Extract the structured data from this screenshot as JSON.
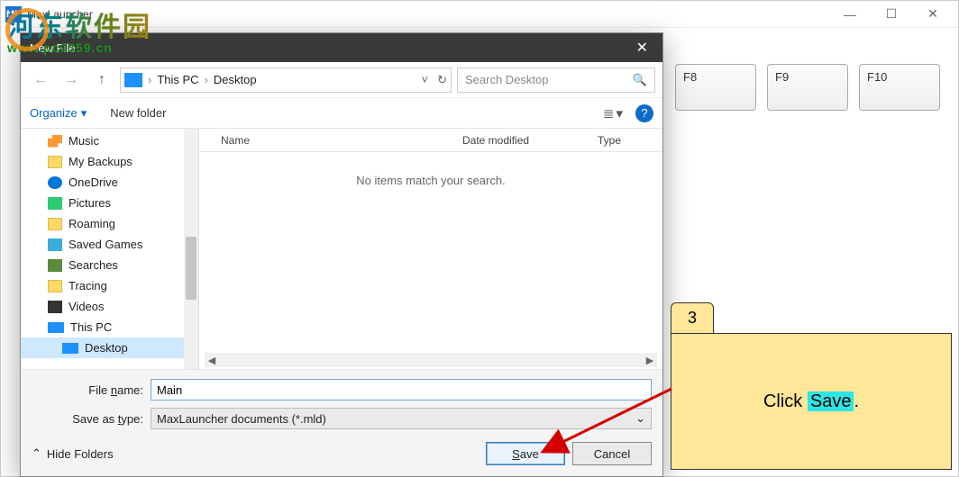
{
  "app": {
    "title": "MaxLauncher",
    "icon_text": "ML",
    "win": {
      "min": "—",
      "max": "☐",
      "close": "✕"
    },
    "f_buttons": [
      "F8",
      "F9",
      "F10"
    ]
  },
  "watermark": {
    "line1": "河东软件园",
    "line2": "www.pc0359.cn"
  },
  "dialog": {
    "title": "New File",
    "close": "✕",
    "nav": {
      "back": "←",
      "forward": "→",
      "up": "↑"
    },
    "breadcrumb": {
      "root_icon": "pc",
      "items": [
        "This PC",
        "Desktop"
      ],
      "sep": "›",
      "dropdown": "˅",
      "refresh": "↻"
    },
    "search": {
      "placeholder": "Search Desktop",
      "icon": "🔍"
    },
    "toolbar": {
      "organize": "Organize",
      "dropdown": "▾",
      "new_folder": "New folder",
      "view": "≣",
      "view_drop": "▾",
      "help": "?"
    },
    "tree": [
      {
        "label": "Music",
        "icon": "i-music"
      },
      {
        "label": "My Backups",
        "icon": "i-folder"
      },
      {
        "label": "OneDrive",
        "icon": "i-onedrive"
      },
      {
        "label": "Pictures",
        "icon": "i-pictures"
      },
      {
        "label": "Roaming",
        "icon": "i-folder"
      },
      {
        "label": "Saved Games",
        "icon": "i-saved"
      },
      {
        "label": "Searches",
        "icon": "i-search"
      },
      {
        "label": "Tracing",
        "icon": "i-folder"
      },
      {
        "label": "Videos",
        "icon": "i-videos"
      },
      {
        "label": "This PC",
        "icon": "i-pc",
        "outdent": true
      },
      {
        "label": "Desktop",
        "icon": "i-pc",
        "indent": true,
        "selected": true
      }
    ],
    "columns": {
      "name": "Name",
      "date": "Date modified",
      "type": "Type"
    },
    "empty": "No items match your search.",
    "filename_label_pre": "File ",
    "filename_label_u": "n",
    "filename_label_post": "ame:",
    "filename_value": "Main",
    "type_label_pre": "Save as ",
    "type_label_u": "t",
    "type_label_post": "ype:",
    "type_value": "MaxLauncher documents (*.mld)",
    "hide_folders": "Hide Folders",
    "hide_arrow": "⌃",
    "save_pre": "",
    "save_u": "S",
    "save_post": "ave",
    "cancel": "Cancel"
  },
  "annotation": {
    "step": "3",
    "text_pre": "Click ",
    "text_hl": "Save",
    "text_post": "."
  }
}
